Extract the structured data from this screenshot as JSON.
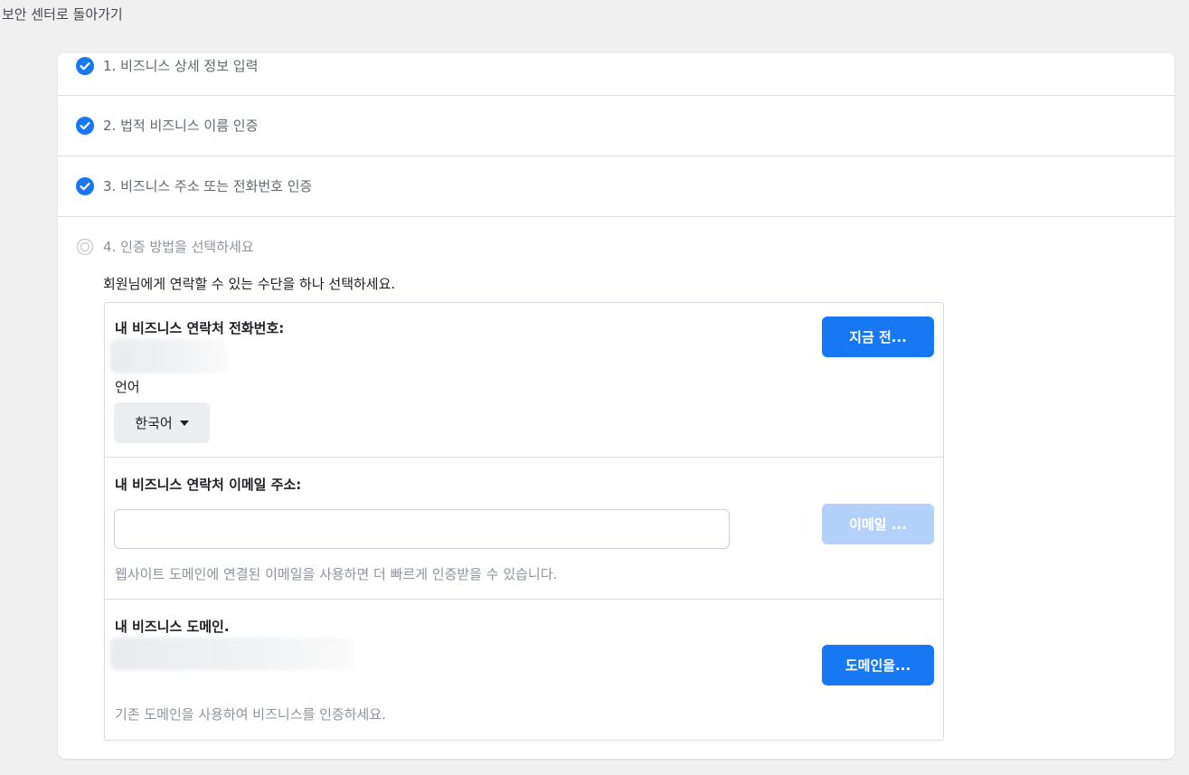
{
  "nav": {
    "back_label": "보안 센터로 돌아가기"
  },
  "steps": [
    {
      "label": "1. 비즈니스 상세 정보 입력",
      "status": "complete"
    },
    {
      "label": "2. 법적 비즈니스 이름 인증",
      "status": "complete"
    },
    {
      "label": "3. 비즈니스 주소 또는 전화번호 인증",
      "status": "complete"
    },
    {
      "label": "4. 인증 방법을 선택하세요",
      "status": "current"
    }
  ],
  "step4": {
    "description": "회원님에게 연락할 수 있는 수단을 하나 선택하세요.",
    "phone": {
      "title": "내 비즈니스 연락처 전화번호:",
      "button_label": "지금 전...",
      "language_label": "언어",
      "language_value": "한국어"
    },
    "email": {
      "title": "내 비즈니스 연락처 이메일 주소:",
      "input_value": "",
      "button_label": "이메일 ...",
      "hint": "웹사이트 도메인에 연결된 이메일을 사용하면 더 빠르게 인증받을 수 있습니다."
    },
    "domain": {
      "title": "내 비즈니스 도메인.",
      "button_label": "도메인을...",
      "hint": "기존 도메인을 사용하여 비즈니스를 인증하세요."
    }
  },
  "colors": {
    "accent": "#1877f2",
    "accent_disabled": "#b2d2fb",
    "check": "#1877f2"
  }
}
